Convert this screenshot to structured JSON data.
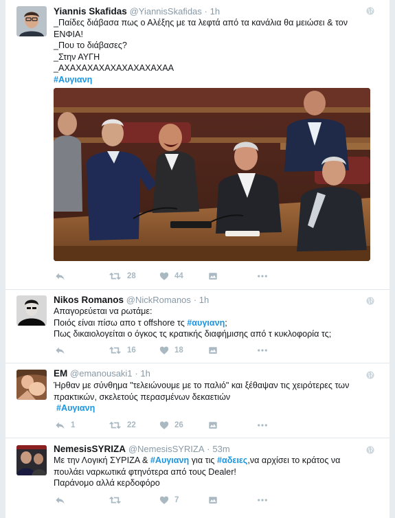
{
  "tweets": [
    {
      "name": "Yiannis Skafidas",
      "handle": "@YiannisSkafidas",
      "dot": "·",
      "time": "1h",
      "lines": [
        "_Παίδες διάβασα πως ο Αλέξης με τα λεφτά από τα κανάλια θα  μειώσει & τον",
        "ΕΝΦΙΑ!",
        "_Που το διάβασες?",
        "_Στην ΑΥΓΗ",
        "_ΑΧΑΧΑΧΑΧΑΧΑΧΑΧΑΧΑΧΑΑ"
      ],
      "hashtag": "#Αυγιανη",
      "retweets": "28",
      "likes": "44"
    },
    {
      "name": "Nikos Romanos",
      "handle": "@NickRomanos",
      "dot": "·",
      "time": "1h",
      "line1": "Απαγορεύεται να ρωτάμε:",
      "line2_pre": "Ποιός είναι πίσω απο τ offshore τς ",
      "line2_tag": "#αυγιανη",
      "line2_post": ";",
      "line3": "Πως δικαιολογείται ο όγκος τς κρατικής διαφήμισης από τ κυκλοφορία τς;",
      "retweets": "16",
      "likes": "18"
    },
    {
      "name": "EM",
      "handle": "@emanousaki1",
      "dot": "·",
      "time": "1h",
      "lines": [
        "Ήρθαν με σύνθημα \"τελειώνουμε με το παλιό\" και ξέθαψαν τις χειρότερες των",
        "πρακτικών, σκελετούς περασμένων δεκαετιών"
      ],
      "hashtag": "#Αυγιανη",
      "replies": "1",
      "retweets": "22",
      "likes": "26"
    },
    {
      "name": "NemesisSYRIZA",
      "handle": "@NemesisSYRIZA",
      "dot": "·",
      "time": "53m",
      "line1_pre": "Με την Λογική ΣΥΡΙΖΑ & ",
      "line1_tag1": "#Αυγιανη",
      "line1_mid": " για τις ",
      "line1_tag2": "#αδειες",
      "line1_post": ",να αρχίσει το κράτος να",
      "line2": "πουλάει ναρκωτικά φτηνότερα από τους Dealer!",
      "line3": "Παράνομο αλλά κερδοφόρο",
      "likes": "7"
    }
  ],
  "colors": {
    "hashtag": "#1b95e0",
    "icon": "#aab8c2",
    "name": "#14171a",
    "meta": "#8899a6"
  },
  "icons": [
    "reply-icon",
    "retweet-icon",
    "heart-icon",
    "message-icon",
    "more-icon",
    "globe-icon"
  ]
}
